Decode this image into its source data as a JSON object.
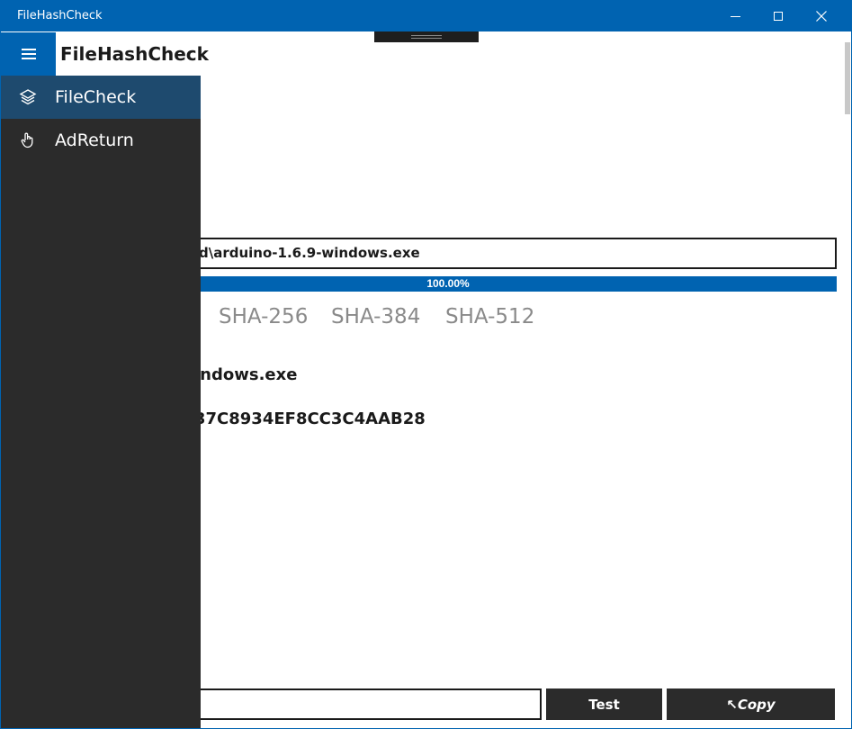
{
  "window": {
    "title": "FileHashCheck"
  },
  "app": {
    "header_title": "FileHashCheck"
  },
  "nav": {
    "items": [
      {
        "label": "FileCheck",
        "icon": "layers-icon",
        "selected": true
      },
      {
        "label": "AdReturn",
        "icon": "hand-pointer-icon",
        "selected": false
      }
    ]
  },
  "main": {
    "file_path_visible": "d\\arduino-1.6.9-windows.exe",
    "progress_value": 1.0,
    "progress_text": "100.00%",
    "hash_tabs": [
      "SHA-256",
      "SHA-384",
      "SHA-512"
    ],
    "file_name_visible": "indows.exe",
    "hash_value_visible": "37C8934EF8CC3C4AAB28",
    "compare_placeholder": ""
  },
  "buttons": {
    "test_label": "Test",
    "copy_label": "↖Copy"
  },
  "colors": {
    "accent": "#0063b1",
    "pane": "#2b2b2b",
    "selected_nav": "#1e4a6e"
  }
}
